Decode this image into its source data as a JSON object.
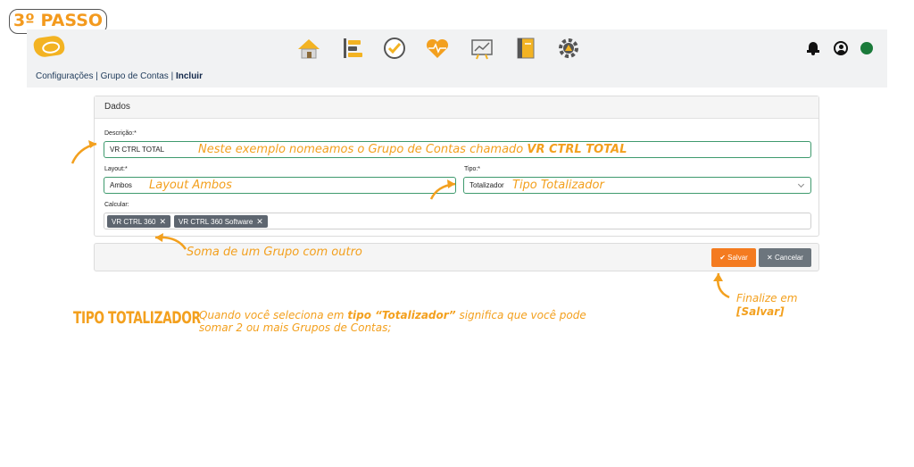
{
  "step_badge": "3º PASSO",
  "header": {
    "nav_icons": [
      "home-icon",
      "list-icon",
      "check-circle-icon",
      "heart-pulse-icon",
      "chart-board-icon",
      "notebook-icon",
      "gear-icon"
    ],
    "right_icons": [
      "bell-icon",
      "user-icon",
      "status-dot"
    ],
    "status_color": "#1a7a3a"
  },
  "breadcrumb": {
    "part1": "Configurações",
    "sep1": " | ",
    "part2": "Grupo de Contas",
    "sep2": " | ",
    "current": "Incluir"
  },
  "form": {
    "panel_title": "Dados",
    "descricao_label": "Descrição:*",
    "descricao_value": "VR CTRL TOTAL",
    "layout_label": "Layout:*",
    "layout_value": "Ambos",
    "tipo_label": "Tipo:*",
    "tipo_value": "Totalizador",
    "calcular_label": "Calcular:",
    "calcular_tags": [
      "VR CTRL 360",
      "VR CTRL 360 Software"
    ],
    "tag_remove": "✕"
  },
  "buttons": {
    "save_icon": "✔",
    "save_label": "Salvar",
    "cancel_icon": "✕",
    "cancel_label": "Cancelar"
  },
  "annotations": {
    "descricao_note": "Neste exemplo nomeamos o Grupo de Contas chamado ",
    "descricao_note_bold": "VR CTRL TOTAL",
    "layout_note": "Layout Ambos",
    "tipo_note": "Tipo Totalizador",
    "soma_note": "Soma de um Grupo com outro",
    "finalize_line1": "Finalize em",
    "finalize_line2": "[Salvar]",
    "tipo_title": "TIPO TOTALIZADOR",
    "tipo_desc_pre": "Quando você seleciona em ",
    "tipo_desc_bold": "tipo “Totalizador”",
    "tipo_desc_post": " significa que você pode",
    "tipo_desc_line2": "somar 2 ou mais Grupos de Contas;"
  },
  "colors": {
    "accent": "#f3a01e",
    "save_button": "#f47b20",
    "cancel_button": "#6c757d",
    "field_border": "#3f9a6e"
  }
}
